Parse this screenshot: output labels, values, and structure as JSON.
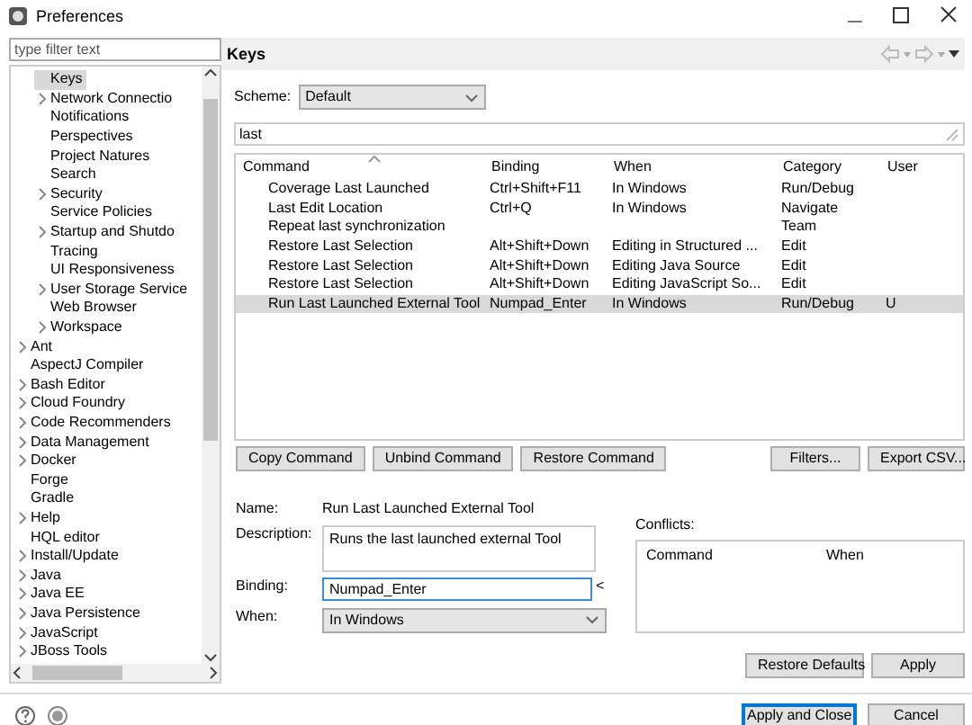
{
  "window": {
    "title": "Preferences"
  },
  "filter": {
    "placeholder": "type filter text"
  },
  "tree": {
    "nested_items": [
      {
        "label": "Keys",
        "expandable": false,
        "selected": true
      },
      {
        "label": "Network Connectio",
        "expandable": true,
        "selected": false
      },
      {
        "label": "Notifications",
        "expandable": false,
        "selected": false
      },
      {
        "label": "Perspectives",
        "expandable": false,
        "selected": false
      },
      {
        "label": "Project Natures",
        "expandable": false,
        "selected": false
      },
      {
        "label": "Search",
        "expandable": false,
        "selected": false
      },
      {
        "label": "Security",
        "expandable": true,
        "selected": false
      },
      {
        "label": "Service Policies",
        "expandable": false,
        "selected": false
      },
      {
        "label": "Startup and Shutdo",
        "expandable": true,
        "selected": false
      },
      {
        "label": "Tracing",
        "expandable": false,
        "selected": false
      },
      {
        "label": "UI Responsiveness",
        "expandable": false,
        "selected": false
      },
      {
        "label": "User Storage Service",
        "expandable": true,
        "selected": false
      },
      {
        "label": "Web Browser",
        "expandable": false,
        "selected": false
      },
      {
        "label": "Workspace",
        "expandable": true,
        "selected": false
      }
    ],
    "items": [
      {
        "label": "Ant",
        "expandable": true,
        "selected": false
      },
      {
        "label": "AspectJ Compiler",
        "expandable": false,
        "selected": false
      },
      {
        "label": "Bash Editor",
        "expandable": true,
        "selected": false
      },
      {
        "label": "Cloud Foundry",
        "expandable": true,
        "selected": false
      },
      {
        "label": "Code Recommenders",
        "expandable": true,
        "selected": false
      },
      {
        "label": "Data Management",
        "expandable": true,
        "selected": false
      },
      {
        "label": "Docker",
        "expandable": true,
        "selected": false
      },
      {
        "label": "Forge",
        "expandable": false,
        "selected": false
      },
      {
        "label": "Gradle",
        "expandable": false,
        "selected": false
      },
      {
        "label": "Help",
        "expandable": true,
        "selected": false
      },
      {
        "label": "HQL editor",
        "expandable": false,
        "selected": false
      },
      {
        "label": "Install/Update",
        "expandable": true,
        "selected": false
      },
      {
        "label": "Java",
        "expandable": true,
        "selected": false
      },
      {
        "label": "Java EE",
        "expandable": true,
        "selected": false
      },
      {
        "label": "Java Persistence",
        "expandable": true,
        "selected": false
      },
      {
        "label": "JavaScript",
        "expandable": true,
        "selected": false
      },
      {
        "label": "JBoss Tools",
        "expandable": true,
        "selected": false
      }
    ]
  },
  "page": {
    "title": "Keys",
    "scheme": {
      "label": "Scheme:",
      "value": "Default"
    },
    "search": {
      "value": "last"
    },
    "table": {
      "columns": [
        "Command",
        "Binding",
        "When",
        "Category",
        "User"
      ],
      "rows": [
        {
          "cells": [
            "Coverage Last Launched",
            "Ctrl+Shift+F11",
            "In Windows",
            "Run/Debug",
            ""
          ],
          "selected": false
        },
        {
          "cells": [
            "Last Edit Location",
            "Ctrl+Q",
            "In Windows",
            "Navigate",
            ""
          ],
          "selected": false
        },
        {
          "cells": [
            "Repeat last synchronization",
            "",
            "",
            "Team",
            ""
          ],
          "selected": false
        },
        {
          "cells": [
            "Restore Last Selection",
            "Alt+Shift+Down",
            "Editing in Structured ...",
            "Edit",
            ""
          ],
          "selected": false
        },
        {
          "cells": [
            "Restore Last Selection",
            "Alt+Shift+Down",
            "Editing Java Source",
            "Edit",
            ""
          ],
          "selected": false
        },
        {
          "cells": [
            "Restore Last Selection",
            "Alt+Shift+Down",
            "Editing JavaScript So...",
            "Edit",
            ""
          ],
          "selected": false
        },
        {
          "cells": [
            "Run Last Launched External Tool",
            "Numpad_Enter",
            "In Windows",
            "Run/Debug",
            "U"
          ],
          "selected": true
        }
      ]
    },
    "command_buttons": [
      "Copy Command",
      "Unbind Command",
      "Restore Command"
    ],
    "table_buttons": [
      "Filters...",
      "Export CSV..."
    ],
    "name": {
      "label": "Name:",
      "value": "Run Last Launched External Tool"
    },
    "description": {
      "label": "Description:",
      "value": "Runs the last launched external Tool"
    },
    "binding": {
      "label": "Binding:",
      "value": "Numpad_Enter",
      "menu": "<"
    },
    "when": {
      "label": "When:",
      "value": "In Windows"
    },
    "conflicts": {
      "label": "Conflicts:",
      "columns": [
        "Command",
        "When"
      ]
    },
    "page_buttons": [
      "Restore Defaults",
      "Apply"
    ]
  },
  "dialog_buttons": [
    {
      "label": "Apply and Close",
      "default": true
    },
    {
      "label": "Cancel",
      "default": false
    }
  ]
}
